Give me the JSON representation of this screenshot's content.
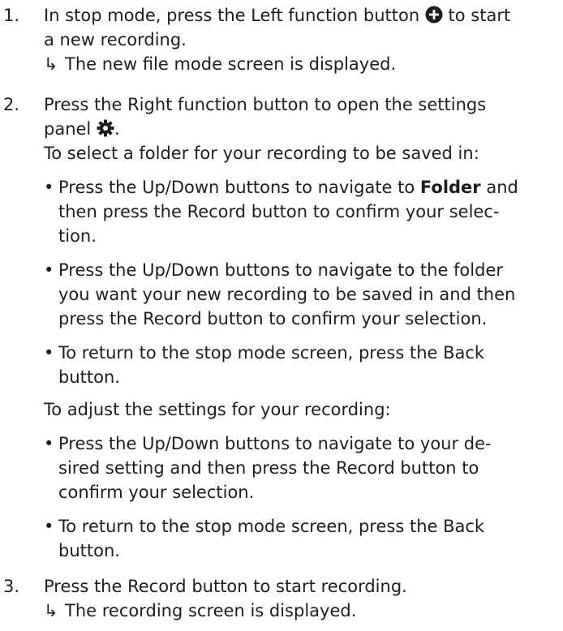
{
  "steps": [
    {
      "number": "1.",
      "line1_before_icon": "In stop mode, press the Left function button",
      "line1_icon": "plus-circle-icon",
      "line1_after_icon": "to start",
      "line2": "a new recording.",
      "result": "The new file mode screen is displayed."
    },
    {
      "number": "2.",
      "line1": "Press the Right function button to open the settings",
      "line2": "panel",
      "line2_icon": "gear-icon",
      "line2_after": ".",
      "folder_intro": "To select a folder for your recording to be saved in:",
      "folder_bullets": [
        {
          "line1_before_bold": "Press the Up/Down buttons to navigate to ",
          "bold": "Folder",
          "line1_after_bold": " and",
          "line2": "then press the Record button to confirm your selec-",
          "line3": "tion."
        },
        {
          "line1": "Press the Up/Down buttons to navigate to the folder",
          "line2": "you want your new recording to be saved in and then",
          "line3": "press the Record button to confirm your selection."
        },
        {
          "line1": "To return to the stop mode screen, press the Back",
          "line2": "button."
        }
      ],
      "settings_intro": "To adjust the settings for your recording:",
      "settings_bullets": [
        {
          "line1": "Press the Up/Down buttons to navigate to your de-",
          "line2": "sired setting and then press the Record button to",
          "line3": "confirm your selection."
        },
        {
          "line1": "To return to the stop mode screen, press the Back",
          "line2": "button."
        }
      ]
    },
    {
      "number": "3.",
      "line1": "Press the Record button to start recording.",
      "result": "The recording screen is displayed."
    }
  ],
  "bullet_char": "•",
  "result_arrow": "↳",
  "colors": {
    "text": "#1d1d1b"
  }
}
